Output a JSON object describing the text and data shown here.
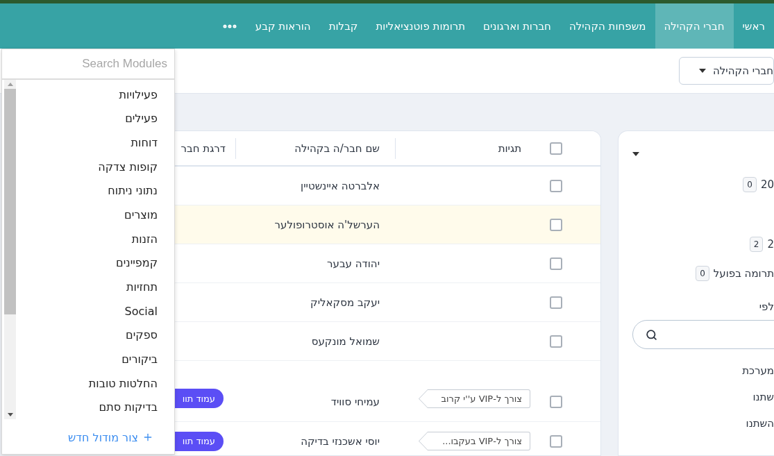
{
  "nav": {
    "items": [
      {
        "label": "ראשי",
        "selected": false
      },
      {
        "label": "חברי הקהילה",
        "selected": true
      },
      {
        "label": "משפחות הקהילה",
        "selected": false
      },
      {
        "label": "חברות וארגונים",
        "selected": false
      },
      {
        "label": "תרומות פוטנציאליות",
        "selected": false
      },
      {
        "label": "קבלות",
        "selected": false
      },
      {
        "label": "הוראות קבע",
        "selected": false
      }
    ]
  },
  "toolbar": {
    "view_select": {
      "value": "חברי הקהילה"
    }
  },
  "summary_panel": {
    "rows": [
      {
        "label": "20",
        "count": "0"
      },
      {
        "label": "2",
        "count": "2"
      },
      {
        "label": "תרומה בפועל",
        "count": "0"
      }
    ],
    "group_label": "לפי",
    "options": [
      "מערכת",
      "שתנו",
      "השתנו"
    ]
  },
  "table": {
    "select_all": {
      "checked": false
    },
    "columns": [
      "תגיות",
      "שם חבר/ה בקהילה",
      "דרגת חבר"
    ],
    "rows": [
      {
        "checked": false,
        "highlighted": false,
        "name": "אלברטה איינשטיין"
      },
      {
        "checked": false,
        "highlighted": true,
        "name": "הערשל'ה אוסטרופולער"
      },
      {
        "checked": false,
        "highlighted": false,
        "name": "יהודה עבער"
      },
      {
        "checked": false,
        "highlighted": false,
        "name": "יעקב מסקאליק"
      },
      {
        "checked": false,
        "highlighted": false,
        "name": "שמואל מונקעס"
      },
      {
        "checked": false,
        "highlighted": false,
        "spaced": true,
        "tag": "צורך ל-VIP ע''י קרוב",
        "name": "עמיחי סוויד",
        "badge": "עמוד תוו"
      },
      {
        "checked": false,
        "highlighted": false,
        "tag": "צורך ל-VIP בעקבו...",
        "name": "יוסי אשכנזי בדיקה",
        "badge": "עמוד תוו"
      }
    ]
  },
  "modules_menu": {
    "search": {
      "placeholder": "Search Modules"
    },
    "items": [
      "פעילויות",
      "פעילים",
      "דוחות",
      "קופות צדקה",
      "נתוני ניתוח",
      "מוצרים",
      "הזנות",
      "קמפיינים",
      "תחזיות",
      "Social",
      "ספקים",
      "ביקורים",
      "החלטות טובות",
      "בדיקות סתם"
    ],
    "create": "צור מודול חדש"
  }
}
